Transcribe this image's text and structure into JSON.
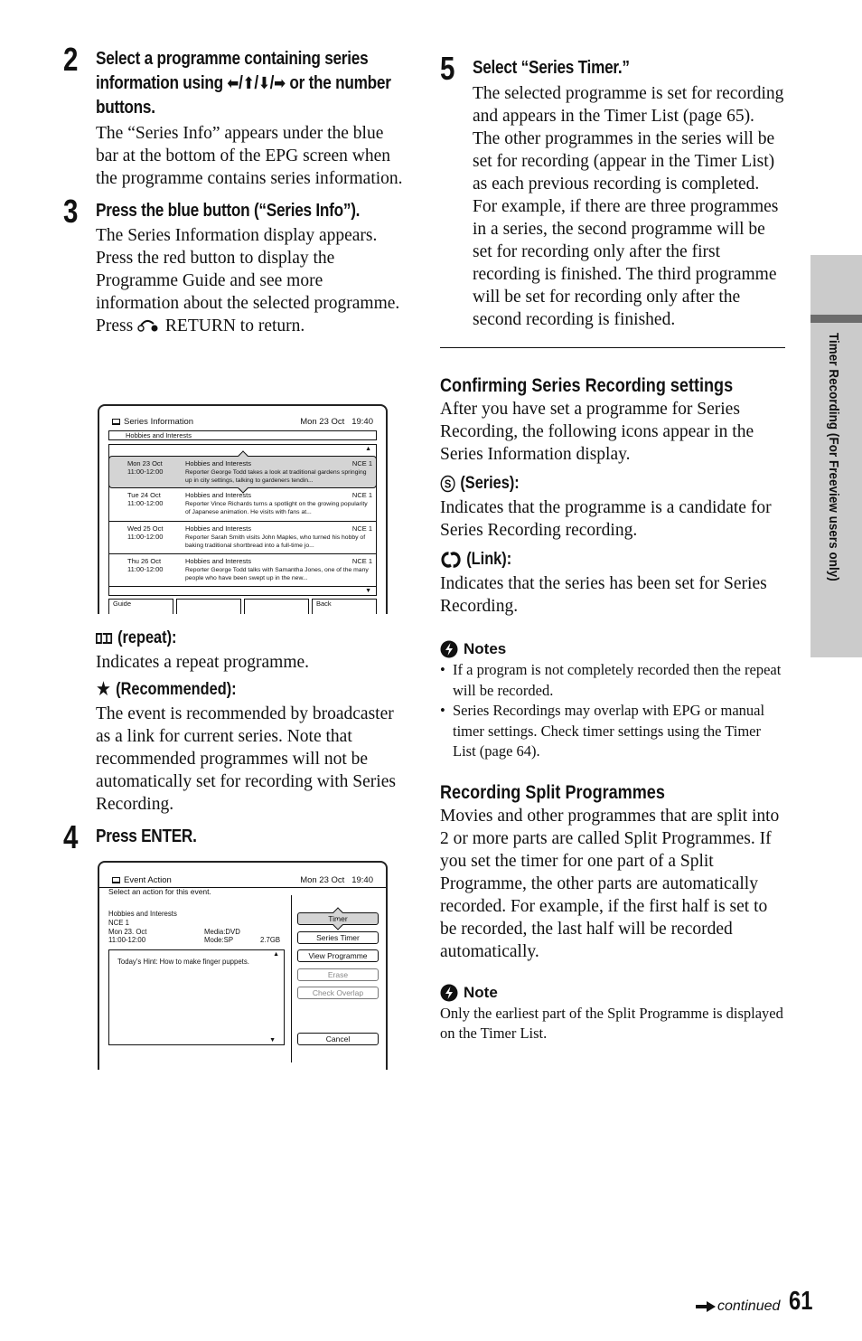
{
  "left_column": {
    "step2": {
      "number": "2",
      "title_part1": "Select a programme containing series information using ",
      "arrow_left": "⬅",
      "arrow_up": "⬆",
      "arrow_down": "⬇",
      "arrow_right": "➡",
      "title_part2": " or the number buttons.",
      "body": "The “Series Info” appears under the blue bar at the bottom of the EPG screen when the programme contains series information."
    },
    "step3": {
      "number": "3",
      "title": "Press the blue button (“Series Info”).",
      "body_part1": "The Series Information display appears. Press the red button to display the Programme Guide and see more information about the selected programme. Press ",
      "return_label": "RETURN",
      "body_part2": " to return."
    },
    "series_info_screen": {
      "title": "Series Information",
      "date": "Mon 23 Oct",
      "time": "19:40",
      "genre": "Hobbies and Interests",
      "rows": [
        {
          "day": "Mon 23 Oct",
          "time": "11:00-12:00",
          "title": "Hobbies and Interests",
          "channel": "NCE 1",
          "desc": "Reporter George Todd takes a look at traditional gardens springing up in city settings, talking to gardeners tendin...",
          "selected": true
        },
        {
          "day": "Tue 24 Oct",
          "time": "11:00-12:00",
          "title": "Hobbies and Interests",
          "channel": "NCE 1",
          "desc": "Reporter Vince Richards turns a spotlight on the growing popularity of Japanese animation. He visits with fans at...",
          "selected": false
        },
        {
          "day": "Wed 25 Oct",
          "time": "11:00-12:00",
          "title": "Hobbies and Interests",
          "channel": "NCE 1",
          "desc": "Reporter Sarah Smith visits John Maples, who turned his hobby of baking traditional shortbread into a full-time jo...",
          "selected": false
        },
        {
          "day": "Thu 26 Oct",
          "time": "11:00-12:00",
          "title": "Hobbies and Interests",
          "channel": "NCE 1",
          "desc": "Reporter George Todd talks with Samantha Jones, one of the many people who have been swept up in the new...",
          "selected": false
        }
      ],
      "color_buttons": [
        "Guide",
        "",
        "",
        "Back"
      ]
    },
    "repeat": {
      "icon": "repeat-icon",
      "label": "(repeat):",
      "body": "Indicates a repeat programme."
    },
    "recommended": {
      "icon": "★",
      "label": "(Recommended):",
      "body": "The event is recommended by broadcaster as a link for current series. Note that recommended programmes will not be automatically set for recording with Series Recording."
    },
    "step4": {
      "number": "4",
      "title": "Press ENTER."
    },
    "event_action_screen": {
      "title": "Event Action",
      "date": "Mon 23 Oct",
      "time": "19:40",
      "prompt": "Select an action for this event.",
      "programme": "Hobbies and Interests",
      "channel": "NCE 1",
      "date_line": "Mon 23. Oct",
      "media": "Media:DVD",
      "time_line": "11:00-12:00",
      "mode": "Mode:SP",
      "size": "2.7GB",
      "hint": "Today’s Hint: How to make finger puppets.",
      "buttons": [
        {
          "label": "Timer",
          "state": "selected"
        },
        {
          "label": "Series Timer",
          "state": "normal"
        },
        {
          "label": "View Programme",
          "state": "normal"
        },
        {
          "label": "Erase",
          "state": "disabled"
        },
        {
          "label": "Check Overlap",
          "state": "disabled"
        },
        {
          "label": "Cancel",
          "state": "normal"
        }
      ]
    }
  },
  "right_column": {
    "step5": {
      "number": "5",
      "title": "Select “Series Timer.”",
      "body1": "The selected programme is set for recording and appears in the Timer List (page 65).  The other programmes in the series will be set for recording (appear in the Timer List) as each previous recording is completed.",
      "body2": "For example, if there are three programmes in a series, the second programme will be set for recording only after the first recording is finished. The third programme will be set for recording only after the second recording is finished."
    },
    "confirming": {
      "heading": "Confirming Series Recording settings",
      "body": "After you have set a programme for Series Recording, the following icons appear in the Series Information display."
    },
    "series_icon": {
      "glyph": "S",
      "label": "(Series):",
      "body": "Indicates that the programme is a candidate for Series Recording recording."
    },
    "link_icon": {
      "label": "(Link):",
      "body": "Indicates that the series has been set for Series Recording."
    },
    "notes": {
      "heading": "Notes",
      "items": [
        "If a program is not completely recorded then the repeat will be recorded.",
        "Series Recordings may overlap with EPG or manual timer settings. Check timer settings using the Timer List (page 64)."
      ]
    },
    "split": {
      "heading": "Recording Split Programmes",
      "body": "Movies and other programmes that are split into 2 or more parts are called Split Programmes. If you set the timer for one part of a Split Programme, the other parts are automatically recorded. For example, if the first half is set to be recorded, the last half will be recorded automatically."
    },
    "note": {
      "heading": "Note",
      "body": "Only the earliest part of the Split Programme is displayed on the Timer List."
    }
  },
  "side_tab": {
    "label": "Timer Recording (For Freeview users only)"
  },
  "footer": {
    "continued": "continued",
    "page_number": "61"
  }
}
